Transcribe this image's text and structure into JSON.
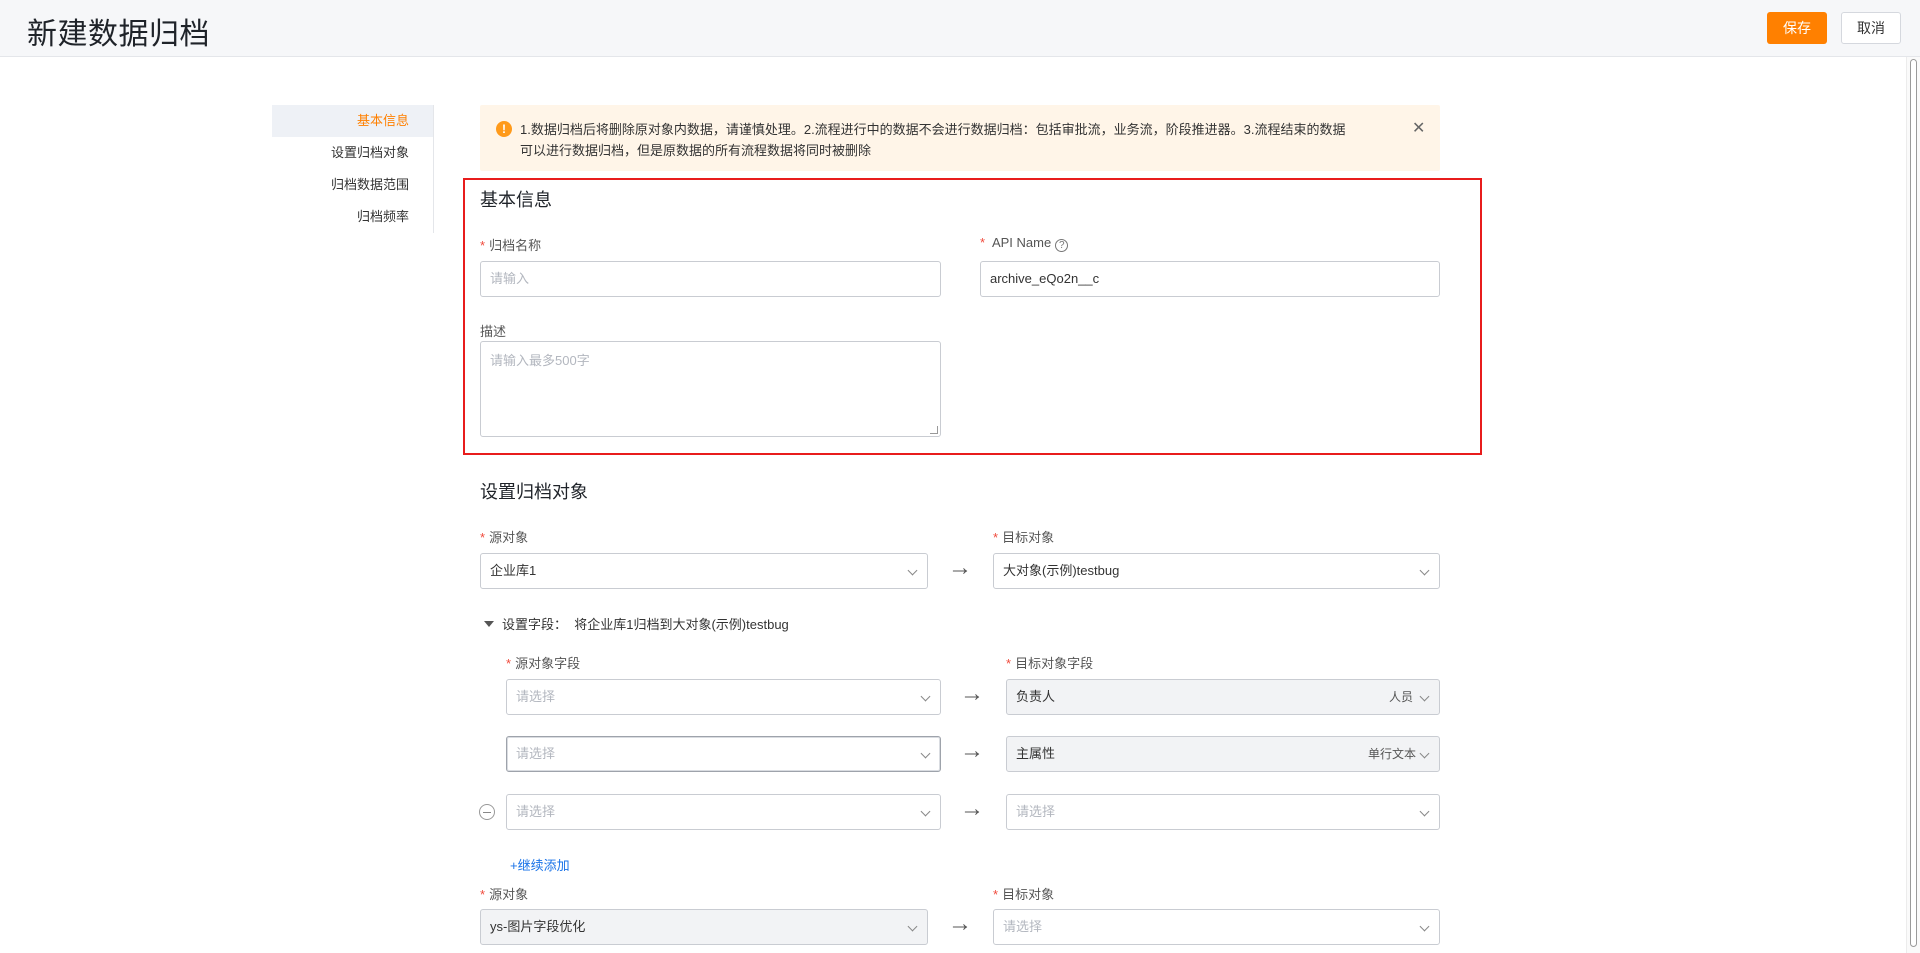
{
  "header": {
    "title": "新建数据归档",
    "save_label": "保存",
    "cancel_label": "取消"
  },
  "side_nav": {
    "items": [
      {
        "label": "基本信息",
        "active": true
      },
      {
        "label": "设置归档对象",
        "active": false
      },
      {
        "label": "归档数据范围",
        "active": false
      },
      {
        "label": "归档频率",
        "active": false
      }
    ]
  },
  "notice": {
    "text_line1": "1.数据归档后将删除原对象内数据，请谨慎处理。2.流程进行中的数据不会进行数据归档：包括审批流，业务流，阶段推进器。3.流程结束的数据",
    "text_line2": "可以进行数据归档，但是原数据的所有流程数据将同时被删除",
    "close": "✕"
  },
  "basic_info": {
    "title": "基本信息",
    "name_label": "归档名称",
    "name_placeholder": "请输入",
    "api_label": "API Name",
    "api_value": "archive_eQo2n__c",
    "desc_label": "描述",
    "desc_placeholder": "请输入最多500字"
  },
  "archive_object": {
    "title": "设置归档对象",
    "source_label": "源对象",
    "target_label": "目标对象",
    "source_value": "企业库1",
    "target_value": "大对象(示例)testbug",
    "fields_toggle": "设置字段：",
    "fields_desc": "将企业库1归档到大对象(示例)testbug",
    "source_field_label": "源对象字段",
    "target_field_label": "目标对象字段",
    "rows": [
      {
        "source_placeholder": "请选择",
        "target_value": "负责人",
        "target_type": "人员"
      },
      {
        "source_placeholder": "请选择",
        "target_value": "主属性",
        "target_type": "单行文本"
      },
      {
        "source_placeholder": "请选择",
        "target_placeholder": "请选择"
      }
    ],
    "add_more": "+继续添加",
    "source2_label": "源对象",
    "target2_label": "目标对象",
    "source2_value": "ys-图片字段优化",
    "target2_placeholder": "请选择"
  },
  "icons": {
    "arrow": "→",
    "help": "?",
    "warning": "!"
  },
  "colors": {
    "accent": "#ff8000",
    "highlight_border": "#e81c1c",
    "link": "#1a73e8",
    "required": "#f04a3c"
  }
}
